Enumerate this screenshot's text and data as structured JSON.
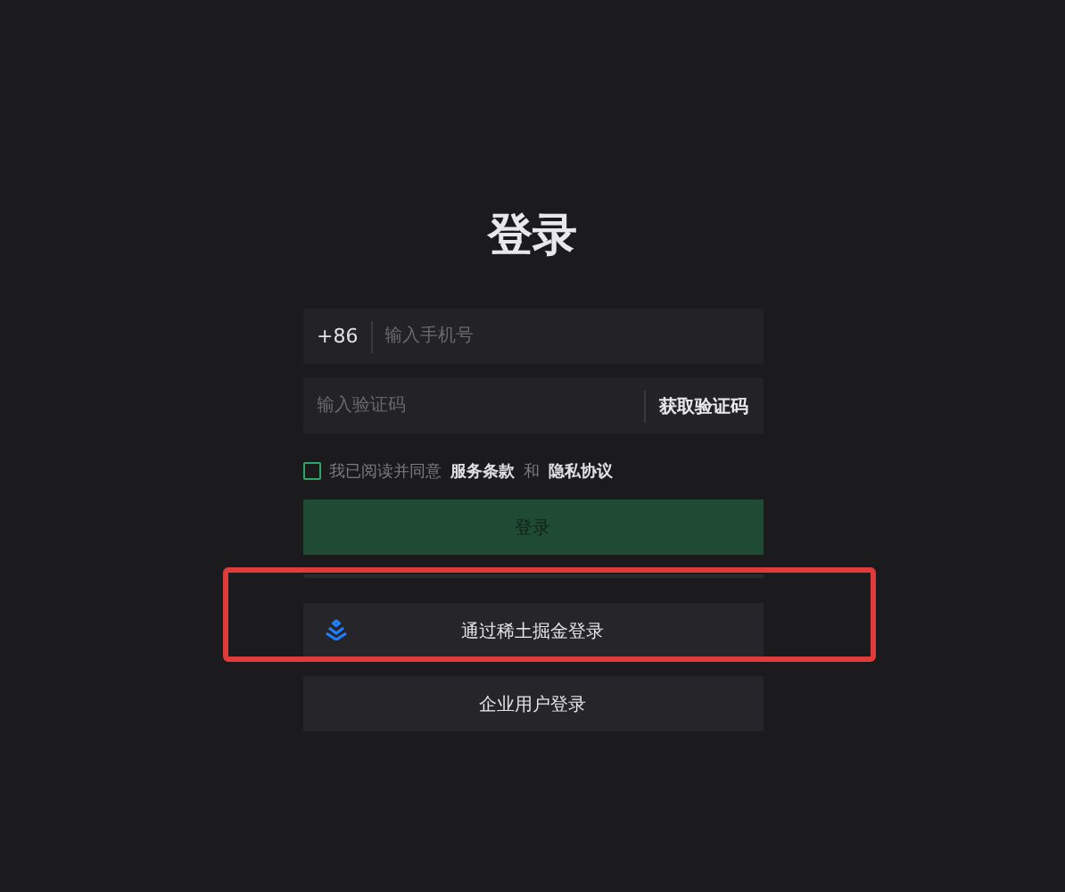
{
  "title": "登录",
  "phone": {
    "prefix": "+86",
    "placeholder": "输入手机号"
  },
  "code": {
    "placeholder": "输入验证码",
    "action": "获取验证码"
  },
  "agreement": {
    "checked": false,
    "parts": [
      {
        "kind": "plain",
        "text": "我已阅读并同意"
      },
      {
        "kind": "link",
        "text": "服务条款"
      },
      {
        "kind": "plain",
        "text": "和"
      },
      {
        "kind": "link",
        "text": "隐私协议"
      }
    ]
  },
  "login_button": {
    "label": "登录",
    "disabled": true
  },
  "alt_logins": [
    {
      "label": "通过稀土掘金登录",
      "kind": "juejin",
      "highlighted": true
    },
    {
      "label": "企业用户登录",
      "kind": "enterprise",
      "highlighted": false
    }
  ]
}
